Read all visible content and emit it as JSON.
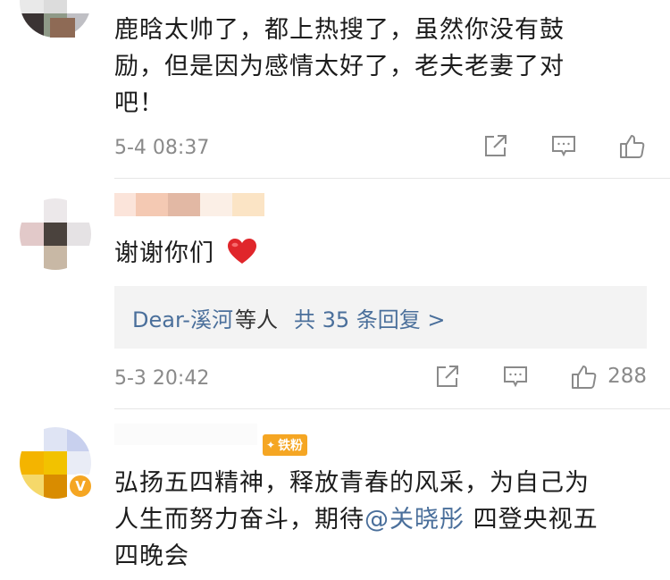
{
  "comments": [
    {
      "text": "鹿晗太帅了，都上热搜了，虽然你没有鼓励，但是因为感情太好了，老夫老妻了对吧！",
      "line1": "鹿晗太帅了，都上热搜了，虽然你没有鼓",
      "line2": "励，但是因为感情太好了，老夫老妻了对",
      "line3": "吧！",
      "time": "5-4 08:37",
      "icons": {
        "forward": "forward-icon",
        "comment": "comment-icon",
        "like": "like-icon"
      }
    },
    {
      "text": "谢谢你们",
      "emoji": "heart-emoji",
      "time": "5-3 20:42",
      "like_count": "288",
      "reply": {
        "who": "Dear-溪河",
        "etc": "等人",
        "count": "共 35 条回复 >"
      }
    },
    {
      "line1": "弘扬五四精神，释放青春的风采，为自己为",
      "line2_a": "人生而努力奋斗，期待",
      "mention": "@关晓彤",
      "line2_b": " 四登央视五",
      "line3": "四晚会",
      "badge": "铁粉",
      "verified": "V"
    }
  ],
  "colors": {
    "link": "#4a6f9b",
    "meta": "#8a8a8a",
    "reply_bg": "#f3f3f3",
    "badge": "#f5a623",
    "heart": "#e0262b"
  }
}
